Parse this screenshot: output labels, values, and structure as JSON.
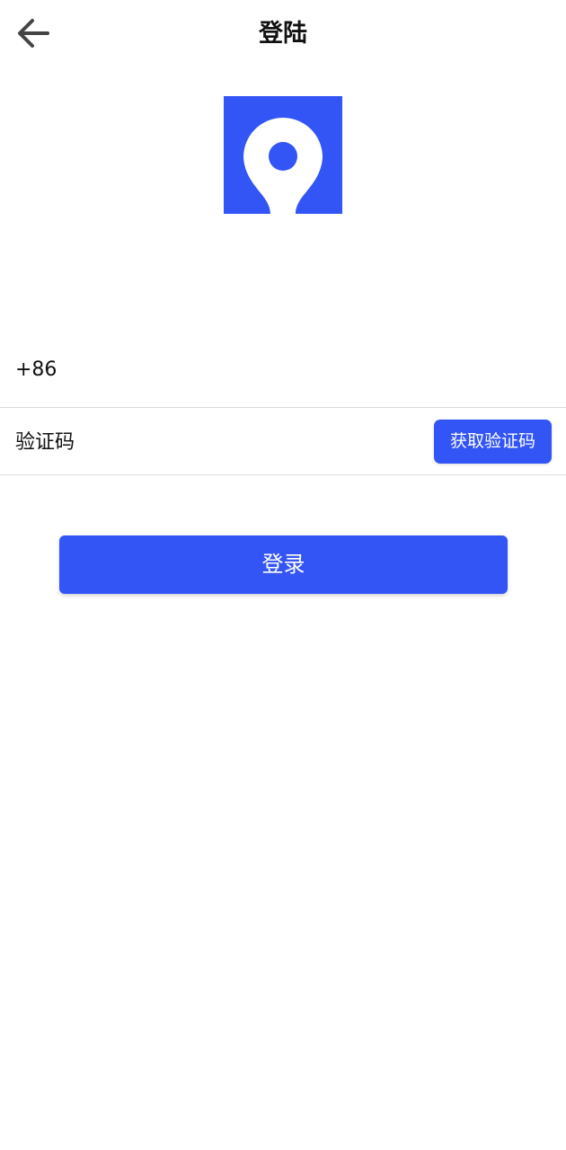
{
  "header": {
    "back_icon": "arrow-left-icon",
    "title": "登陆"
  },
  "logo": {
    "icon": "location-pin-icon",
    "color": "#3355f5"
  },
  "form": {
    "phone_prefix": "+86",
    "phone_value": "",
    "code_placeholder": "验证码",
    "code_value": "",
    "get_code_label": "获取验证码"
  },
  "actions": {
    "login_label": "登录"
  },
  "colors": {
    "primary": "#3355f5",
    "divider": "#dcdcdc",
    "text": "#111111",
    "background": "#ffffff"
  }
}
